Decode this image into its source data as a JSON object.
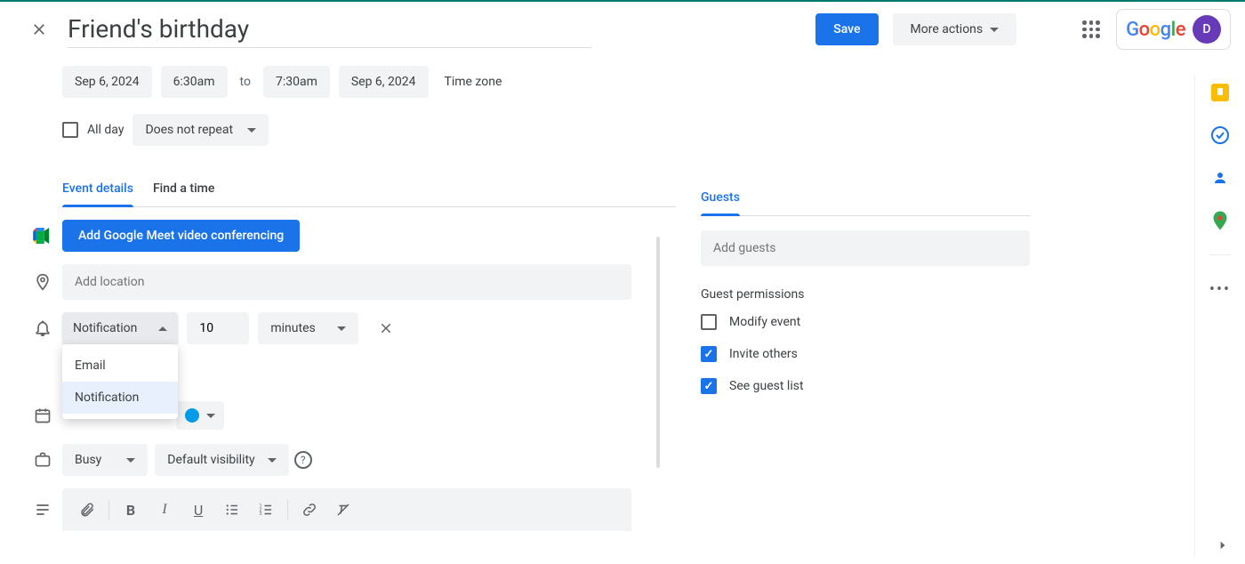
{
  "header": {
    "title": "Friend's birthday",
    "save": "Save",
    "more_actions": "More actions",
    "avatar_letter": "D"
  },
  "datetime": {
    "start_date": "Sep 6, 2024",
    "start_time": "6:30am",
    "to": "to",
    "end_time": "7:30am",
    "end_date": "Sep 6, 2024",
    "timezone_link": "Time zone",
    "all_day_label": "All day",
    "all_day_checked": false,
    "repeat": "Does not repeat"
  },
  "tabs": {
    "event_details": "Event details",
    "find_a_time": "Find a time"
  },
  "details": {
    "meet_button": "Add Google Meet video conferencing",
    "location_placeholder": "Add location",
    "notification": {
      "type_label": "Notification",
      "value": "10",
      "unit": "minutes",
      "menu_email": "Email",
      "menu_notification": "Notification"
    },
    "busy": "Busy",
    "visibility": "Default visibility"
  },
  "guests": {
    "tab": "Guests",
    "add_placeholder": "Add guests",
    "permissions_title": "Guest permissions",
    "modify_label": "Modify event",
    "modify_checked": false,
    "invite_label": "Invite others",
    "invite_checked": true,
    "seelist_label": "See guest list",
    "seelist_checked": true
  }
}
